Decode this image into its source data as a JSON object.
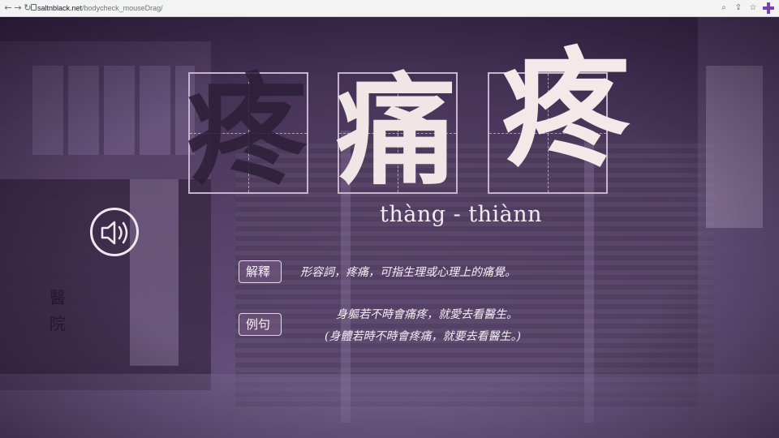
{
  "browser": {
    "url_host": "saltnblack.net",
    "url_path": "/bodycheck_mouseDrag/",
    "icons": [
      "back-icon",
      "forward-icon",
      "reload-icon",
      "lock-icon",
      "zoom-icon",
      "share-icon",
      "star-icon",
      "extension-icon"
    ]
  },
  "word": {
    "chars": [
      "疼",
      "痛",
      "疼"
    ],
    "romanization": "thàng - thiànn"
  },
  "side_text": [
    "醫",
    "院"
  ],
  "definition": {
    "label": "解釋",
    "text": "形容詞，疼痛，可指生理或心理上的痛覺。"
  },
  "example": {
    "label": "例句",
    "line1": "身軀若不時會痛疼，就愛去看醫生。",
    "line2": "(身體若時不時會疼痛，就要去看醫生。)"
  },
  "colors": {
    "accent_purple": "#7b3fb0",
    "background": "#4d3a5e",
    "text_light": "#f3ebef"
  }
}
